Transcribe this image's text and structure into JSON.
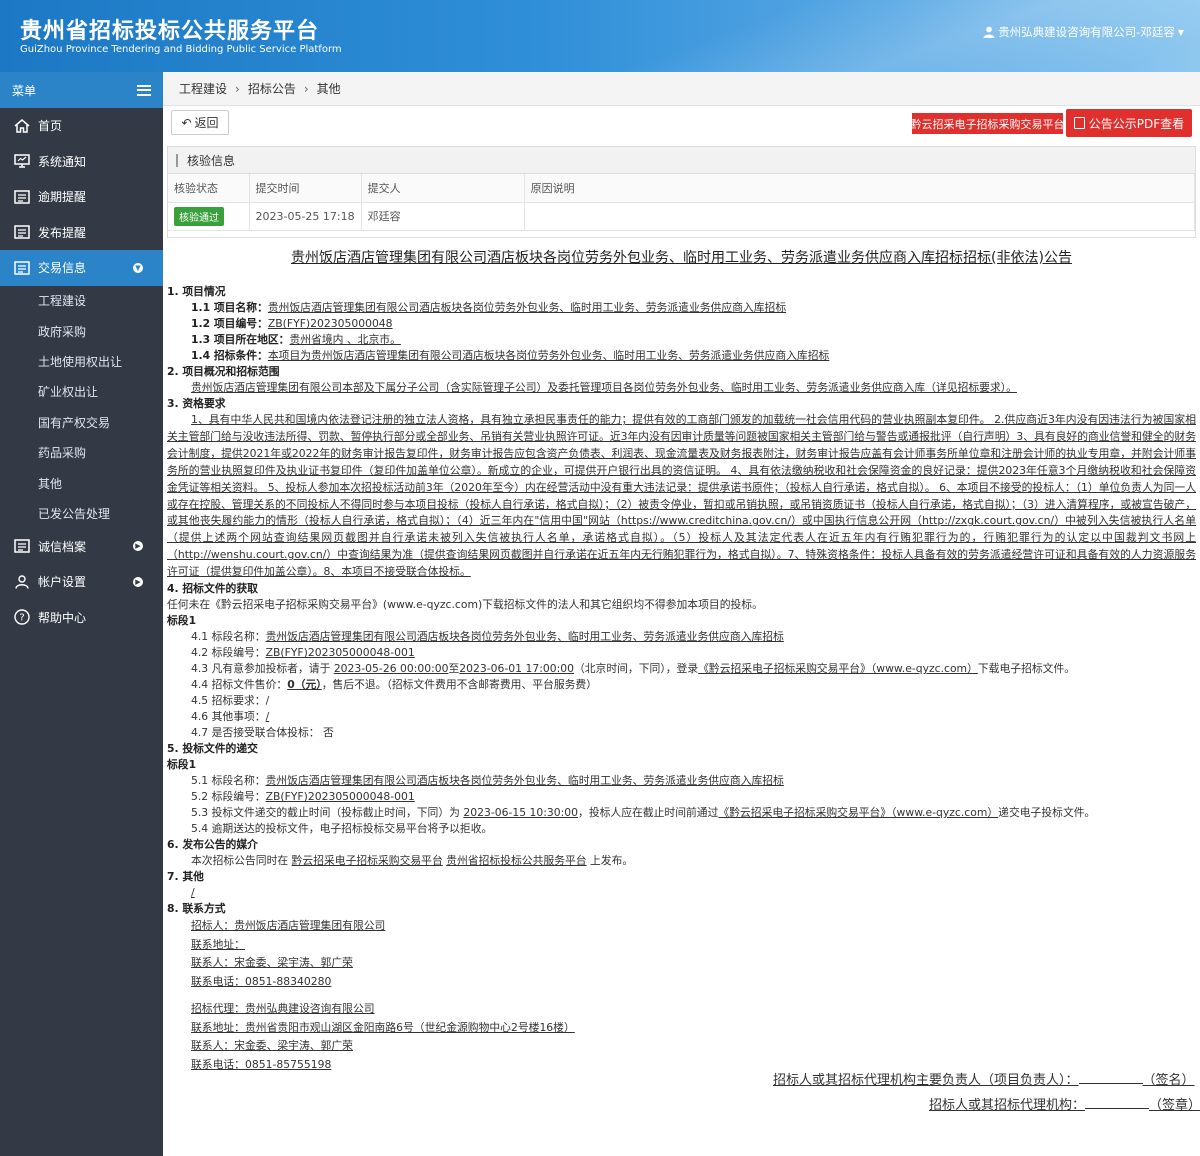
{
  "header": {
    "title_cn": "贵州省招标投标公共服务平台",
    "title_en": "GuiZhou Province Tendering and Bidding Public Service Platform",
    "user": "贵州弘典建设咨询有限公司-邓廷容"
  },
  "sidebar": {
    "menu_label": "菜单",
    "items": [
      {
        "label": "首页",
        "icon": "home-icon"
      },
      {
        "label": "系统通知",
        "icon": "monitor-icon"
      },
      {
        "label": "逾期提醒",
        "icon": "list-icon"
      },
      {
        "label": "发布提醒",
        "icon": "list-icon"
      },
      {
        "label": "交易信息",
        "icon": "list-icon"
      },
      {
        "label": "诚信档案",
        "icon": "list-icon"
      },
      {
        "label": "帐户设置",
        "icon": "user-icon"
      },
      {
        "label": "帮助中心",
        "icon": "help-icon"
      }
    ],
    "sub_items": [
      "工程建设",
      "政府采购",
      "土地使用权出让",
      "矿业权出让",
      "国有产权交易",
      "药品采购",
      "其他",
      "已发公告处理"
    ]
  },
  "breadcrumb": [
    "工程建设",
    "招标公告",
    "其他"
  ],
  "toolbar": {
    "back_label": "返回",
    "platform_label": "黔云招采电子招标采购交易平台",
    "pdf_label": "公告公示PDF查看"
  },
  "verify": {
    "title": "核验信息",
    "headers": [
      "核验状态",
      "提交时间",
      "提交人",
      "原因说明"
    ],
    "status": "核验通过",
    "time": "2023-05-25 17:18",
    "submitter": "邓廷容",
    "reason": "",
    "status_color": "#39a03b"
  },
  "doc": {
    "title": "贵州饭店酒店管理集团有限公司酒店板块各岗位劳务外包业务、临时用工业务、劳务派遣业务供应商入库招标招标(非依法)公告",
    "s1": "1. 项目情况",
    "s1_1k": "1.1 项目名称：",
    "s1_1v": "贵州饭店酒店管理集团有限公司酒店板块各岗位劳务外包业务、临时用工业务、劳务派遣业务供应商入库招标",
    "s1_2k": "1.2 项目编号：",
    "s1_2v": "ZB(FYF)202305000048",
    "s1_3k": "1.3 项目所在地区：",
    "s1_3v": "贵州省境内 、北京市。",
    "s1_4k": "1.4 招标条件：",
    "s1_4v": "本项目为贵州饭店酒店管理集团有限公司酒店板块各岗位劳务外包业务、临时用工业务、劳务派遣业务供应商入库招标",
    "s2": "2. 项目概况和招标范围",
    "s2_t": "贵州饭店酒店管理集团有限公司本部及下属分子公司（含实际管理子公司）及委托管理项目各岗位劳务外包业务、临时用工业务、劳务派遣业务供应商入库（详见招标要求）。",
    "s3": "3. 资格要求",
    "s3_t": "1、具有中华人民共和国境内依法登记注册的独立法人资格，具有独立承担民事责任的能力；提供有效的工商部门颁发的加载统一社会信用代码的营业执照副本复印件。 2.供应商近3年内没有因违法行为被国家相关主管部门给与没收违法所得、罚款、暂停执行部分或全部业务、吊销有关营业执照许可证。近3年内没有因审计质量等问题被国家相关主管部门给与警告或通报批评（自行声明）3、具有良好的商业信誉和健全的财务会计制度，提供2021年或2022年的财务审计报告复印件，财务审计报告应包含资产负债表、利润表、现金流量表及财务报表附注，财务审计报告应盖有会计师事务所单位章和注册会计师的执业专用章，并附会计师事务所的营业执照复印件及执业证书复印件（复印件加盖单位公章）。新成立的企业，可提供开户银行出具的资信证明。 4、具有依法缴纳税收和社会保障资金的良好记录：提供2023年任意3个月缴纳税收和社会保障资金凭证等相关资料。 5、投标人参加本次招投标活动前3年（2020年至今）内在经营活动中没有重大违法记录：提供承诺书原件；（投标人自行承诺，格式自拟）。 6、本项目不接受的投标人：（1）单位负责人为同一人或存在控股、管理关系的不同投标人不得同时参与本项目投标（投标人自行承诺，格式自拟）；（2）被责令停业，暂扣或吊销执照，或吊销资质证书（投标人自行承诺，格式自拟）；（3）进入清算程序，或被宣告破产，或其他丧失履约能力的情形（投标人自行承诺，格式自拟）；（4）近三年内在\"信用中国\"网站（https://www.creditchina.gov.cn/）或中国执行信息公开网（http://zxgk.court.gov.cn/）中被列入失信被执行人名单（提供上述两个网站查询结果网页截图并自行承诺未被列入失信被执行人名单，承诺格式自拟）。（5）投标人及其法定代表人在近五年内有行贿犯罪行为的，行贿犯罪行为的认定以中国裁判文书网上（http://wenshu.court.gov.cn/）中查询结果为准（提供查询结果网页截图并自行承诺在近五年内无行贿犯罪行为，格式自拟）。7、特殊资格条件：投标人具备有效的劳务派遣经营许可证和具备有效的人力资源服务许可证（提供复印件加盖公章）。8、本项目不接受联合体投标。",
    "s4": "4. 招标文件的获取",
    "s4_t": "任何未在《黔云招采电子招标采购交易平台》(www.e-qyzc.com)下载招标文件的法人和其它组织均不得参加本项目的投标。",
    "seg1": "标段1",
    "s4_1k": "4.1 标段名称：",
    "s4_1v": "贵州饭店酒店管理集团有限公司酒店板块各岗位劳务外包业务、临时用工业务、劳务派遣业务供应商入库招标",
    "s4_2k": "4.2 标段编号：",
    "s4_2v": "ZB(FYF)202305000048-001",
    "s4_3a": "4.3 凡有意参加投标者，请于 ",
    "s4_3b": "2023-05-26 00:00:00",
    "s4_3c": "至",
    "s4_3d": "2023-06-01 17:00:00",
    "s4_3e": "（北京时间，下同），登录",
    "s4_3f": "《黔云招采电子招标采购交易平台》（www.e-qyzc.com）",
    "s4_3g": "下载电子招标文件。",
    "s4_4k": "4.4 招标文件售价：",
    "s4_4v": "0（元）",
    "s4_4e": "，售后不退。（招标文件费用不含邮寄费用、平台服务费）",
    "s4_5": "4.5 招标要求：/",
    "s4_6k": "4.6 其他事项：",
    "s4_6v": "/",
    "s4_7": "4.7 是否接受联合体投标：  否",
    "s5": "5. 投标文件的递交",
    "s5_1k": "5.1 标段名称：",
    "s5_1v": "贵州饭店酒店管理集团有限公司酒店板块各岗位劳务外包业务、临时用工业务、劳务派遣业务供应商入库招标",
    "s5_2k": "5.2 标段编号：",
    "s5_2v": "ZB(FYF)202305000048-001",
    "s5_3a": "5.3 投标文件递交的截止时间（投标截止时间，下同）为 ",
    "s5_3b": "2023-06-15 10:30:00",
    "s5_3c": "，投标人应在截止时间前通过",
    "s5_3d": "《黔云招采电子招标采购交易平台》（www.e-qyzc.com）",
    "s5_3e": "递交电子投标文件。",
    "s5_4": "5.4 逾期送达的投标文件，电子招标投标交易平台将予以拒收。",
    "s6": "6. 发布公告的媒介",
    "s6_a": "本次招标公告同时在 ",
    "s6_b": "黔云招采电子招标采购交易平台",
    "s6_c": " ",
    "s6_d": "贵州省招标投标公共服务平台",
    "s6_e": " 上发布。",
    "s7": "7. 其他",
    "s7_t": "/",
    "s8": "8. 联系方式",
    "c1": "招标人：贵州饭店酒店管理集团有限公司",
    "c2": "联系地址：",
    "c3": "联系人：宋金委、梁宇涛、郭广荣",
    "c4": "联系电话：0851-88340280",
    "c5": "招标代理：贵州弘典建设咨询有限公司",
    "c6": "联系地址：贵州省贵阳市观山湖区金阳南路6号（世纪金源购物中心2号楼16楼）",
    "c7": "联系人：宋金委、梁宇涛、郭广荣",
    "c8": "联系电话：0851-85755198"
  },
  "sign": {
    "l1": "招标人或其招标代理机构主要负责人（项目负责人）：",
    "l1_end": "（签名）",
    "l2": "招标人或其招标代理机构：",
    "l2_end": "（签章）"
  },
  "colors": {
    "accent": "#2b84c8",
    "sidebar": "#333a46",
    "danger": "#e0302d"
  }
}
